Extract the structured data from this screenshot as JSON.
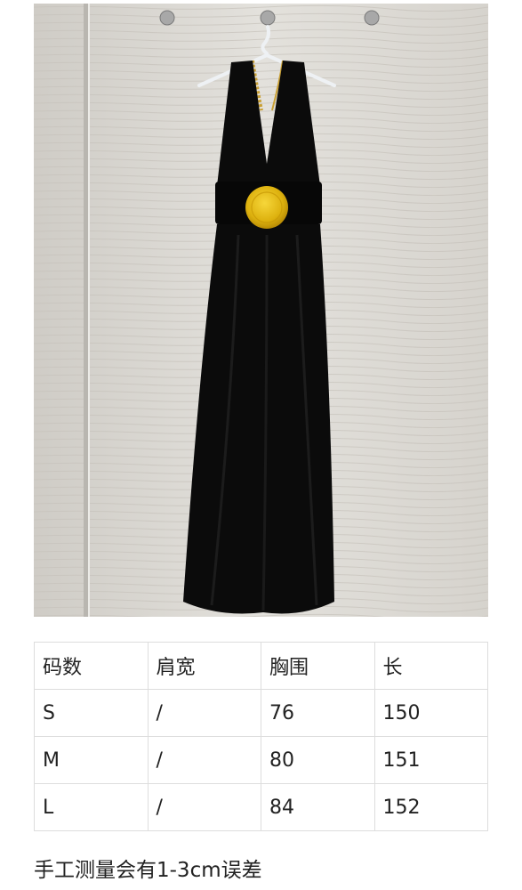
{
  "size_table": {
    "headers": [
      "码数",
      "肩宽",
      "胸围",
      "长"
    ],
    "rows": [
      [
        "S",
        "/",
        "76",
        "150"
      ],
      [
        "M",
        "/",
        "80",
        "151"
      ],
      [
        "L",
        "/",
        "84",
        "152"
      ]
    ]
  },
  "note": "手工测量会有1-3cm误差",
  "colors": {
    "dress": "#0b0b0b",
    "medallion": "#e0b20f",
    "wall": "#dcd9d3",
    "table_border": "#dddddd"
  }
}
